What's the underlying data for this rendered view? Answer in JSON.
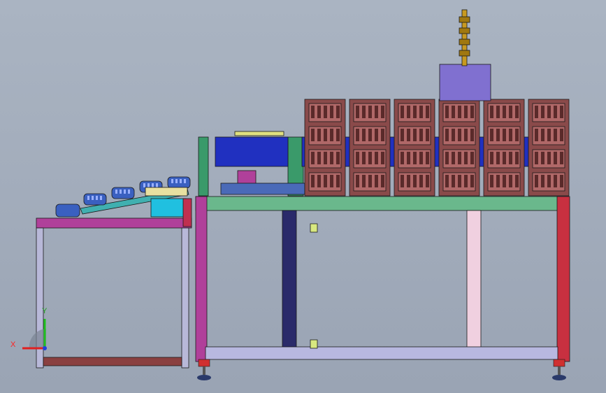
{
  "viewport": {
    "background": "#a4aebc",
    "triad": {
      "x_label": "X",
      "y_label": "Y"
    }
  },
  "colors": {
    "frame_magenta": "#b0409a",
    "frame_green": "#6ab88c",
    "frame_red": "#c83040",
    "frame_lilac": "#b8b8e0",
    "frame_navy": "#2a2a6a",
    "crate": "#8a4a4a",
    "crate_dark": "#5a2a2a",
    "blue_plate": "#2030c0",
    "purple_box": "#8070d0",
    "stack_light": "#c89a20",
    "cyan_box": "#20c0e0",
    "cradle": "#3a60c0",
    "chute": "#40b0b0",
    "wood": "#e8e0a0"
  },
  "model": {
    "icons": [
      "crate-rack",
      "blue-cradle",
      "signal-tower",
      "caster-foot",
      "coordinate-triad"
    ]
  }
}
